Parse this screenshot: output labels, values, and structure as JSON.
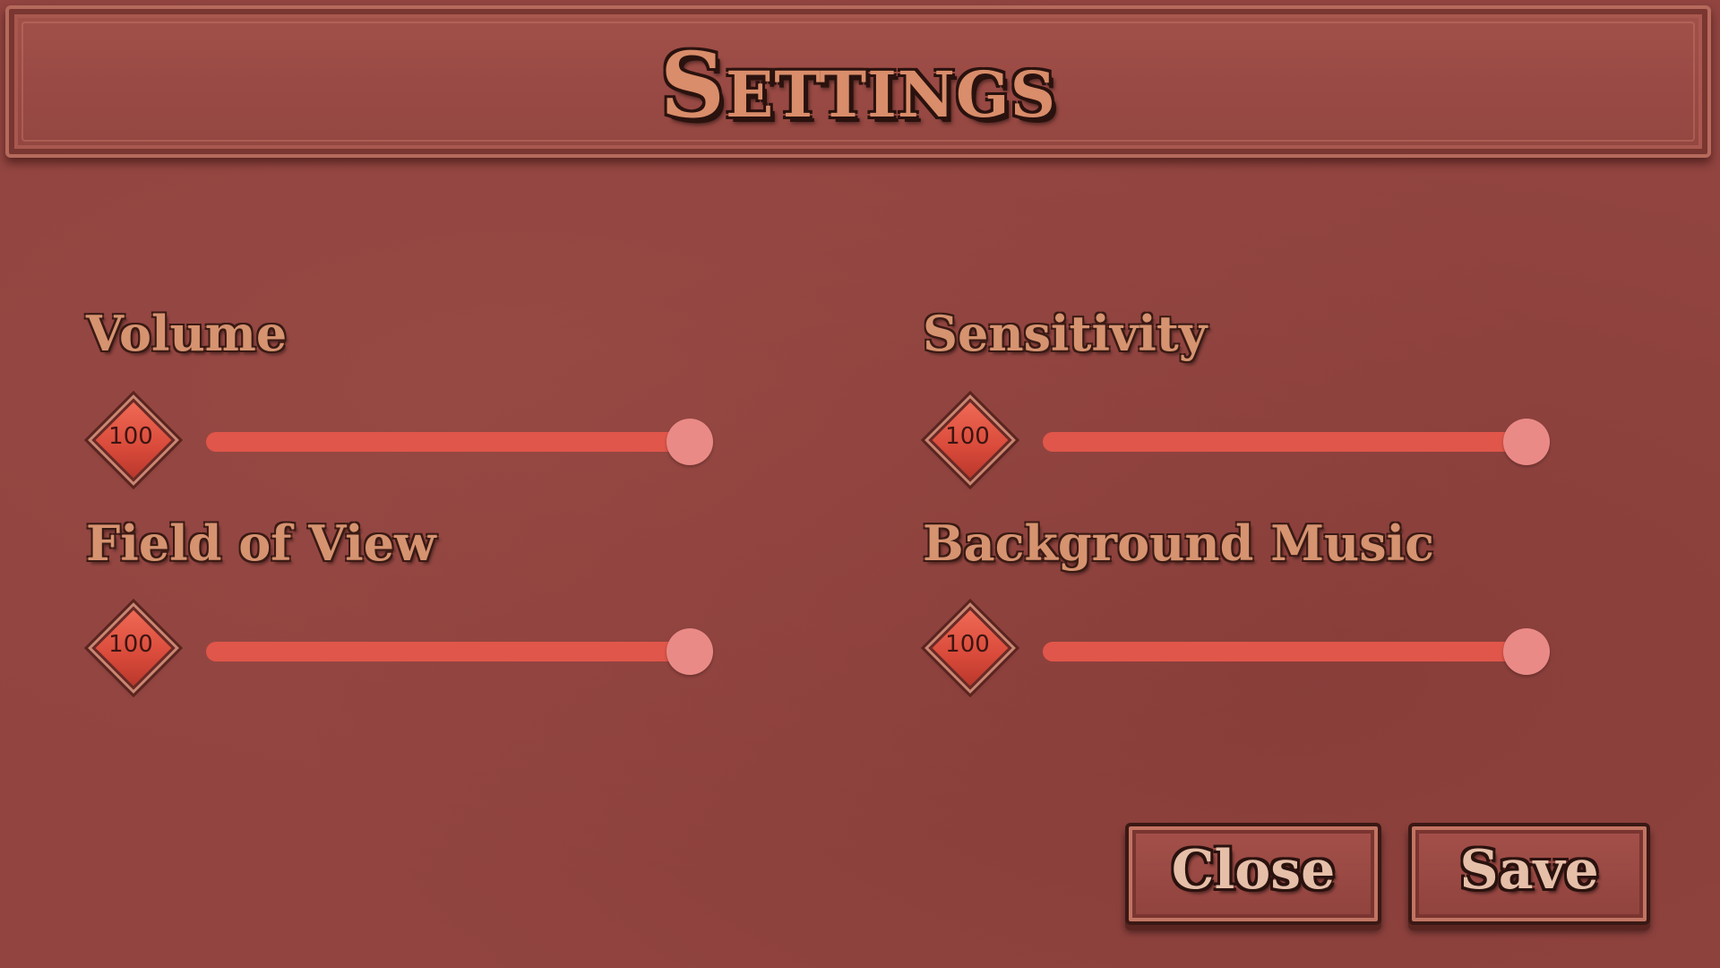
{
  "header": {
    "title": "Settings"
  },
  "settings": [
    {
      "label": "Volume",
      "value": "100",
      "fraction": 1.0
    },
    {
      "label": "Sensitivity",
      "value": "100",
      "fraction": 1.0
    },
    {
      "label": "Field of View",
      "value": "100",
      "fraction": 1.0
    },
    {
      "label": "Background Music",
      "value": "100",
      "fraction": 1.0
    }
  ],
  "buttons": {
    "close_label": "Close",
    "save_label": "Save"
  },
  "colors": {
    "background": "#914440",
    "slider_fill": "#e0564a",
    "slider_handle": "#ea8a86",
    "label_text": "#d69370"
  }
}
